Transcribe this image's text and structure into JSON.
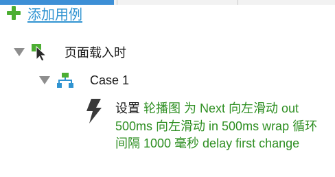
{
  "header": {
    "add_case_label": "添加用例"
  },
  "tree": {
    "event": {
      "label": "页面载入时"
    },
    "case": {
      "label": "Case 1"
    },
    "action": {
      "verb": "设置",
      "detail": "轮播图 为 Next 向左滑动 out 500ms 向左滑动 in 500ms wrap 循环间隔 1000 毫秒 delay first change"
    }
  },
  "colors": {
    "accent_blue": "#3d8fd6",
    "link_blue": "#2f93d1",
    "action_green": "#2e8f22",
    "plus_green": "#4cae32"
  },
  "icons": {
    "add": "plus-icon",
    "event": "cursor-event-icon",
    "case": "case-tree-icon",
    "action": "lightning-icon",
    "collapse": "caret-down-icon"
  }
}
